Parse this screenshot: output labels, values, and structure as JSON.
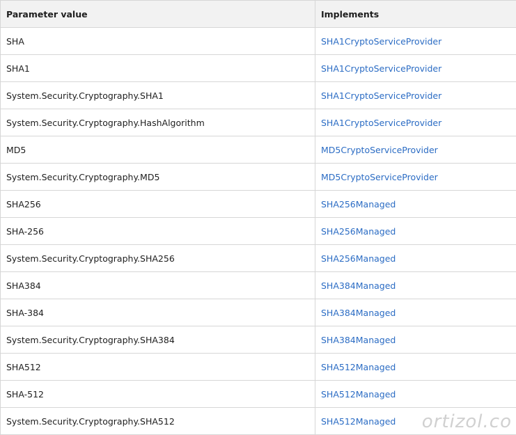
{
  "table": {
    "headers": {
      "parameter": "Parameter value",
      "implements": "Implements"
    },
    "rows": [
      {
        "parameter": "SHA",
        "implements": "SHA1CryptoServiceProvider"
      },
      {
        "parameter": "SHA1",
        "implements": "SHA1CryptoServiceProvider"
      },
      {
        "parameter": "System.Security.Cryptography.SHA1",
        "implements": "SHA1CryptoServiceProvider"
      },
      {
        "parameter": "System.Security.Cryptography.HashAlgorithm",
        "implements": "SHA1CryptoServiceProvider"
      },
      {
        "parameter": "MD5",
        "implements": "MD5CryptoServiceProvider"
      },
      {
        "parameter": "System.Security.Cryptography.MD5",
        "implements": "MD5CryptoServiceProvider"
      },
      {
        "parameter": "SHA256",
        "implements": "SHA256Managed"
      },
      {
        "parameter": "SHA-256",
        "implements": "SHA256Managed"
      },
      {
        "parameter": "System.Security.Cryptography.SHA256",
        "implements": "SHA256Managed"
      },
      {
        "parameter": "SHA384",
        "implements": "SHA384Managed"
      },
      {
        "parameter": "SHA-384",
        "implements": "SHA384Managed"
      },
      {
        "parameter": "System.Security.Cryptography.SHA384",
        "implements": "SHA384Managed"
      },
      {
        "parameter": "SHA512",
        "implements": "SHA512Managed"
      },
      {
        "parameter": "SHA-512",
        "implements": "SHA512Managed"
      },
      {
        "parameter": "System.Security.Cryptography.SHA512",
        "implements": "SHA512Managed"
      }
    ]
  },
  "watermark": "ortizol.co",
  "colors": {
    "link": "#2b6cc4",
    "header_bg": "#f2f2f2",
    "border": "#d6d6d6",
    "text": "#1e1e1e"
  }
}
